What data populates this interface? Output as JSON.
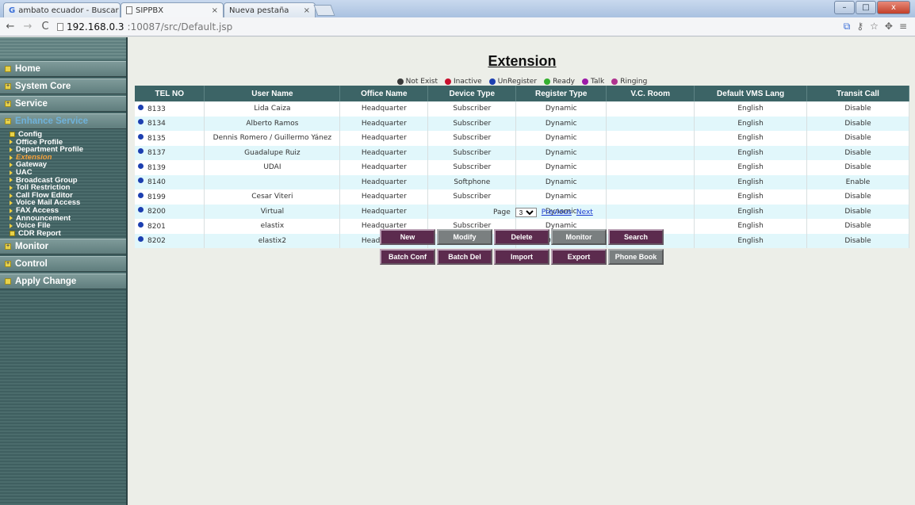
{
  "browser": {
    "tabs": [
      {
        "label": "ambato ecuador - Buscar",
        "icon": "google-icon"
      },
      {
        "label": "SIPPBX",
        "icon": "page-icon"
      },
      {
        "label": "Nueva pestaña",
        "icon": "none"
      }
    ],
    "tab_close": "×",
    "url_host": "192.168.0.3",
    "url_path": ":10087/src/Default.jsp",
    "window_buttons": {
      "minimize": "–",
      "maximize": "□",
      "close": "x"
    }
  },
  "sidebar": {
    "menu": [
      {
        "label": "Home",
        "icon": "square-icon"
      },
      {
        "label": "System Core",
        "icon": "plus-icon"
      },
      {
        "label": "Service",
        "icon": "plus-icon"
      },
      {
        "label": "Enhance Service",
        "icon": "minus-icon"
      }
    ],
    "submenu": [
      {
        "label": "Config",
        "type": "box"
      },
      {
        "label": "Office Profile",
        "type": "tri"
      },
      {
        "label": "Department Profile",
        "type": "tri"
      },
      {
        "label": "Extension",
        "type": "tri",
        "selected": true
      },
      {
        "label": "Gateway",
        "type": "tri"
      },
      {
        "label": "UAC",
        "type": "tri"
      },
      {
        "label": "Broadcast Group",
        "type": "tri"
      },
      {
        "label": "Toll Restriction",
        "type": "tri"
      },
      {
        "label": "Call Flow Editor",
        "type": "tri"
      },
      {
        "label": "Voice Mail Access",
        "type": "tri"
      },
      {
        "label": "FAX Access",
        "type": "tri"
      },
      {
        "label": "Announcement",
        "type": "tri"
      },
      {
        "label": "Voice File",
        "type": "tri"
      },
      {
        "label": "CDR Report",
        "type": "box"
      }
    ],
    "menu_bottom": [
      {
        "label": "Monitor",
        "icon": "plus-icon"
      },
      {
        "label": "Control",
        "icon": "plus-icon"
      },
      {
        "label": "Apply Change",
        "icon": "square-icon"
      }
    ]
  },
  "page": {
    "title": "Extension",
    "legend": [
      {
        "label": "Not Exist",
        "color": "#3a3a3a"
      },
      {
        "label": "Inactive",
        "color": "#c8102e"
      },
      {
        "label": "UnRegister",
        "color": "#1c3fb0"
      },
      {
        "label": "Ready",
        "color": "#35b030"
      },
      {
        "label": "Talk",
        "color": "#9b1aa8"
      },
      {
        "label": "Ringing",
        "color": "#b0338f"
      }
    ],
    "columns": [
      "TEL NO",
      "User Name",
      "Office Name",
      "Device Type",
      "Register Type",
      "V.C. Room",
      "Default VMS Lang",
      "Transit Call"
    ],
    "rows": [
      [
        "8133",
        "Lida Caiza",
        "Headquarter",
        "Subscriber",
        "Dynamic",
        "",
        "English",
        "Disable"
      ],
      [
        "8134",
        "Alberto Ramos",
        "Headquarter",
        "Subscriber",
        "Dynamic",
        "",
        "English",
        "Disable"
      ],
      [
        "8135",
        "Dennis Romero / Guillermo Yánez",
        "Headquarter",
        "Subscriber",
        "Dynamic",
        "",
        "English",
        "Disable"
      ],
      [
        "8137",
        "Guadalupe Ruiz",
        "Headquarter",
        "Subscriber",
        "Dynamic",
        "",
        "English",
        "Disable"
      ],
      [
        "8139",
        "UDAI",
        "Headquarter",
        "Subscriber",
        "Dynamic",
        "",
        "English",
        "Disable"
      ],
      [
        "8140",
        "",
        "Headquarter",
        "Softphone",
        "Dynamic",
        "",
        "English",
        "Enable"
      ],
      [
        "8199",
        "Cesar Viteri",
        "Headquarter",
        "Subscriber",
        "Dynamic",
        "",
        "English",
        "Disable"
      ],
      [
        "8200",
        "Virtual",
        "Headquarter",
        "",
        "Dynamic",
        "",
        "English",
        "Disable"
      ],
      [
        "8201",
        "elastix",
        "Headquarter",
        "Subscriber",
        "Dynamic",
        "",
        "English",
        "Disable"
      ],
      [
        "8202",
        "elastix2",
        "Headquarter",
        "Subscriber",
        "Dynamic",
        "",
        "English",
        "Disable"
      ]
    ],
    "pager": {
      "label": "Page",
      "selected": "3",
      "prev": "Previous",
      "next": "Next"
    },
    "buttons_row1": [
      "New",
      "Modify",
      "Delete",
      "Monitor",
      "Search"
    ],
    "buttons_row2": [
      "Batch Conf",
      "Batch Del",
      "Import",
      "Export",
      "Phone Book"
    ]
  }
}
